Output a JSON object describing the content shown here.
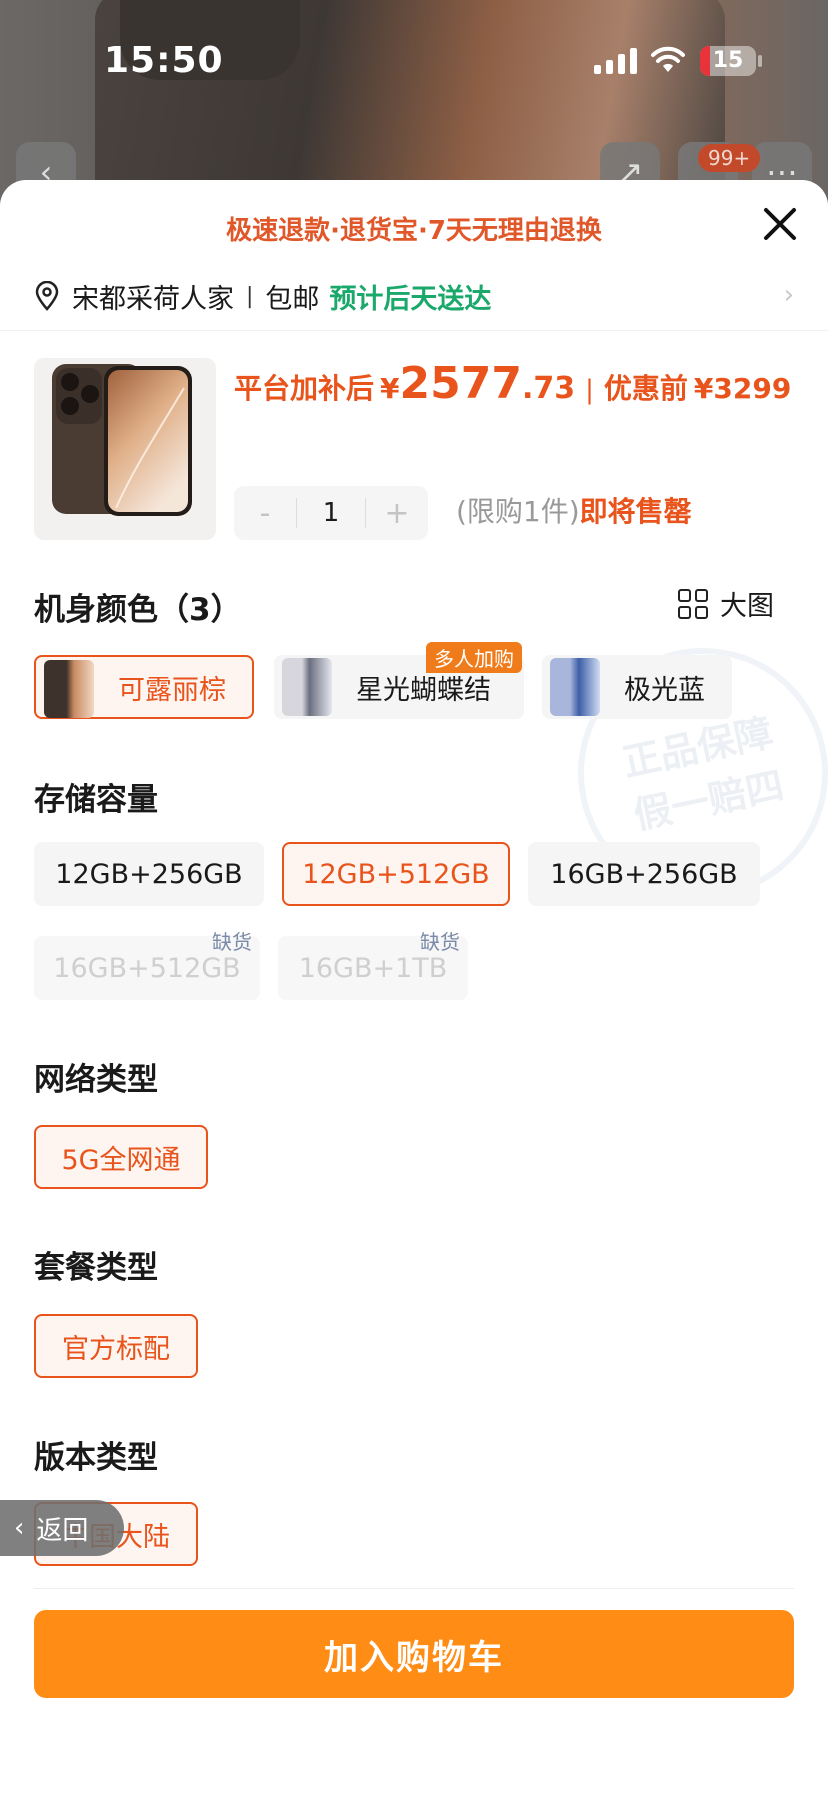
{
  "status_bar": {
    "time": "15:50",
    "battery": "15"
  },
  "background": {
    "cart_badge": "99+"
  },
  "sheet": {
    "banner": "极速退款·退货宝·7天无理由退换",
    "address": "宋都采荷人家",
    "shipping": "包邮",
    "delivery": "预计后天送达",
    "price": {
      "after_label": "平台加补后",
      "currency": "¥",
      "integer": "2577",
      "decimal": ".73",
      "before_label": "优惠前",
      "before_price": "3299"
    },
    "quantity": {
      "minus": "-",
      "value": "1",
      "plus": "+"
    },
    "limit_text": "(限购1件)",
    "limit_soon": "即将售罄",
    "big_image_label": "大图",
    "color_section": {
      "title": "机身颜色（3）",
      "options": [
        {
          "label": "可露丽棕",
          "selected": true,
          "tag": ""
        },
        {
          "label": "星光蝴蝶结",
          "selected": false,
          "tag": "多人加购"
        },
        {
          "label": "极光蓝",
          "selected": false,
          "tag": ""
        }
      ]
    },
    "storage_section": {
      "title": "存储容量",
      "options": [
        {
          "label": "12GB+256GB",
          "state": "normal",
          "tag": ""
        },
        {
          "label": "12GB+512GB",
          "state": "selected",
          "tag": ""
        },
        {
          "label": "16GB+256GB",
          "state": "normal",
          "tag": ""
        },
        {
          "label": "16GB+512GB",
          "state": "disabled",
          "tag": "缺货"
        },
        {
          "label": "16GB+1TB",
          "state": "disabled",
          "tag": "缺货"
        }
      ]
    },
    "network_section": {
      "title": "网络类型",
      "options": [
        {
          "label": "5G全网通",
          "selected": true
        }
      ]
    },
    "package_section": {
      "title": "套餐类型",
      "options": [
        {
          "label": "官方标配",
          "selected": true
        }
      ]
    },
    "version_section": {
      "title": "版本类型",
      "options": [
        {
          "label": "中国大陆",
          "selected": true
        }
      ]
    },
    "back_button": "返回",
    "add_to_cart": "加入购物车",
    "colors": {
      "accent": "#e8541c",
      "cart": "#ff8c14",
      "green": "#1aa86b"
    }
  }
}
